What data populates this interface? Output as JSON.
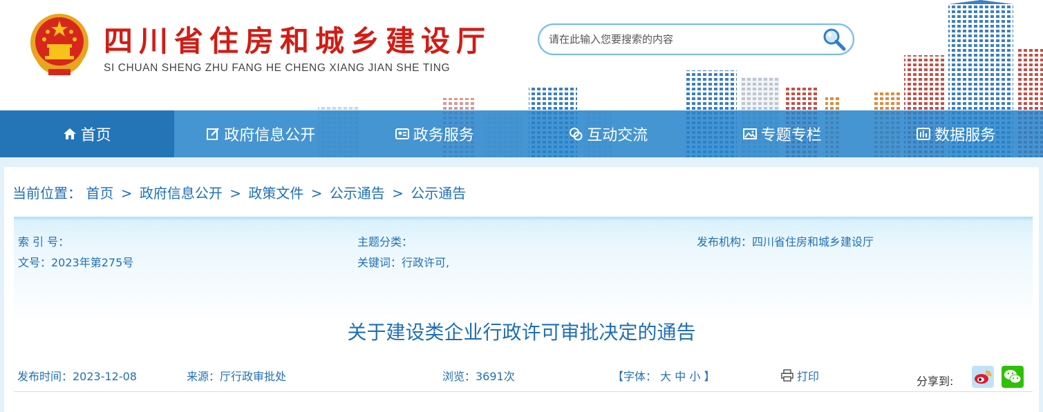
{
  "header": {
    "site_title": "四川省住房和城乡建设厅",
    "site_pinyin": "SI CHUAN SHENG ZHU FANG HE CHENG XIANG JIAN SHE TING",
    "search_placeholder": "请在此输入您要搜索的内容"
  },
  "nav": {
    "items": [
      {
        "label": "首页",
        "icon": "home-icon"
      },
      {
        "label": "政府信息公开",
        "icon": "edit-icon"
      },
      {
        "label": "政务服务",
        "icon": "id-card-icon"
      },
      {
        "label": "互动交流",
        "icon": "chat-icon"
      },
      {
        "label": "专题专栏",
        "icon": "picture-icon"
      },
      {
        "label": "数据服务",
        "icon": "bar-chart-icon"
      }
    ]
  },
  "breadcrumb": {
    "prefix": "当前位置：",
    "items": [
      "首页",
      "政府信息公开",
      "政策文件",
      "公示通告",
      "公示通告"
    ],
    "separator": ">"
  },
  "meta": {
    "index_no": "索 引 号：",
    "doc_no": "文号：2023年第275号",
    "topic": "主题分类：",
    "keywords": "关键词：行政许可,",
    "publisher": "发布机构：四川省住房和城乡建设厅"
  },
  "article": {
    "title": "关于建设类企业行政许可审批决定的通告",
    "publish_time": "发布时间：2023-12-08",
    "source": "来源：厅行政审批处",
    "views": "浏览：3691次",
    "font_label": "【字体：",
    "font_large": "大",
    "font_medium": "中",
    "font_small": "小",
    "font_close": "】",
    "print_label": "打印",
    "share_label": "分享到:"
  },
  "colors": {
    "title_red": "#d21c14",
    "nav_blue": "#2684cb",
    "link_blue": "#1f6fb7",
    "weibo_bg": "#bfe3f5",
    "wechat_green": "#2dc100"
  }
}
